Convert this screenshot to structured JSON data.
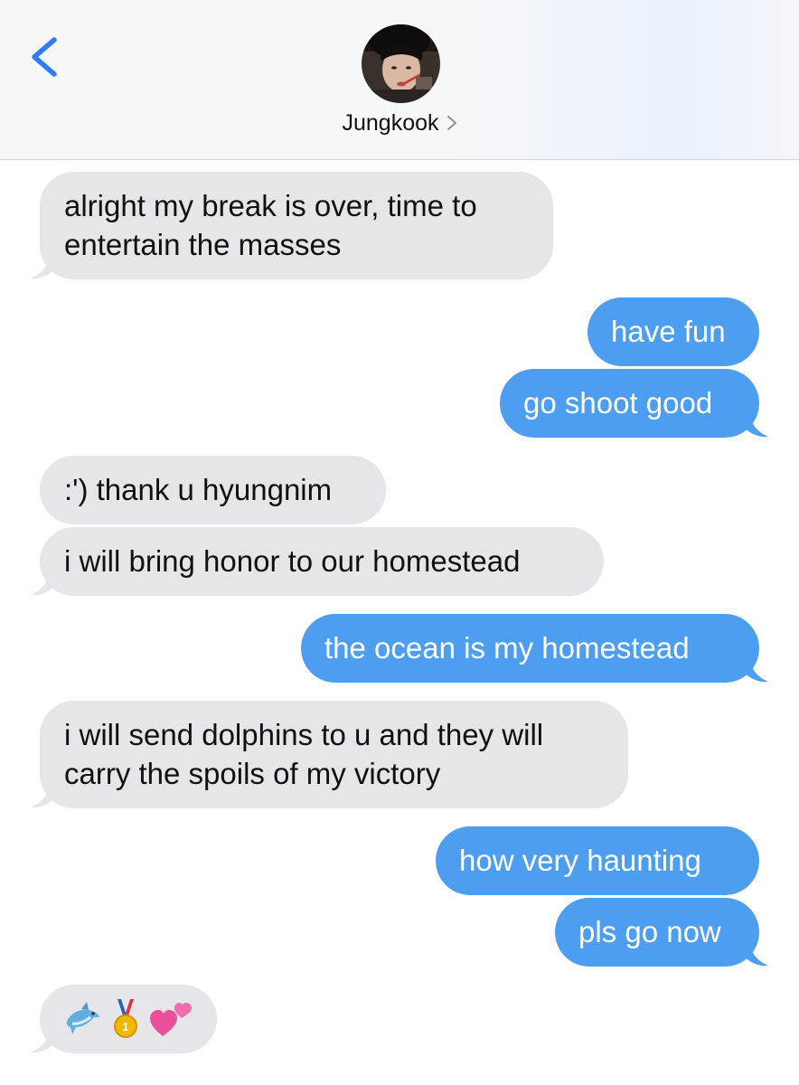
{
  "header": {
    "contact_name": "Jungkook",
    "colors": {
      "back": "#2f7cf6",
      "header_bg": "#f7f7f8"
    }
  },
  "messages": [
    {
      "from": "them",
      "text": "alright my break is over, time to entertain the masses",
      "lines": [
        "alright my break is over, time to",
        "entertain the masses"
      ]
    },
    {
      "from": "me",
      "text": "have fun"
    },
    {
      "from": "me",
      "text": "go shoot good"
    },
    {
      "from": "them",
      "text": ":') thank u hyungnim"
    },
    {
      "from": "them",
      "text": "i will bring honor to our homestead"
    },
    {
      "from": "me",
      "text": "the ocean is my homestead"
    },
    {
      "from": "them",
      "text": "i will send dolphins to u and they will carry the spoils of my victory",
      "lines": [
        "i will send dolphins to u and they will",
        "carry the spoils of my victory"
      ]
    },
    {
      "from": "me",
      "text": "how very haunting"
    },
    {
      "from": "me",
      "text": "pls go now"
    },
    {
      "from": "them",
      "emojis": [
        "dolphin-emoji",
        "gold-medal-emoji",
        "two-hearts-emoji"
      ]
    }
  ],
  "colors": {
    "incoming_bubble": "#e5e5ea",
    "outgoing_bubble": "#4d9ef0",
    "incoming_text": "#111111",
    "outgoing_text": "#ffffff"
  }
}
